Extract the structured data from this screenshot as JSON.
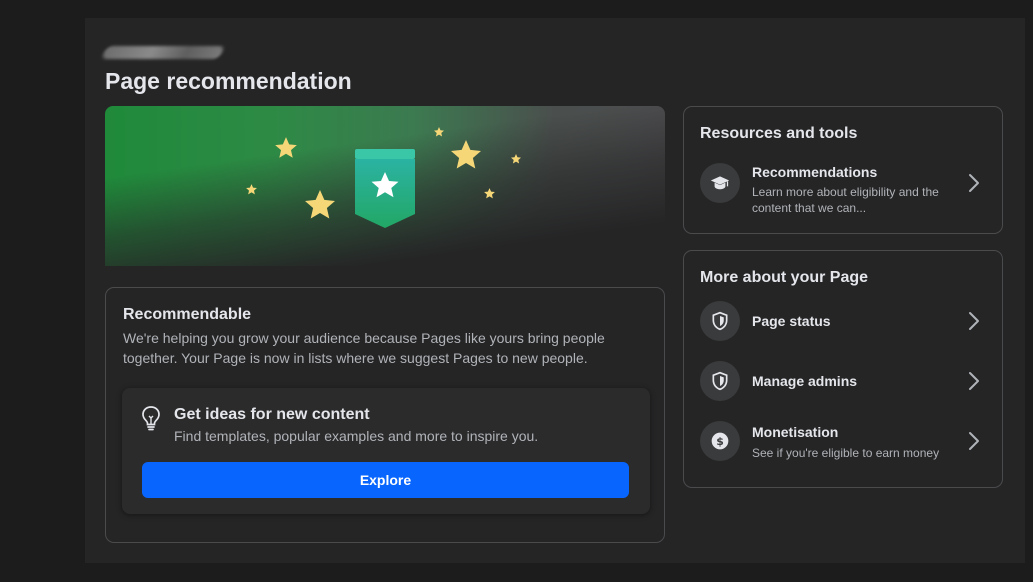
{
  "page": {
    "title": "Page recommendation"
  },
  "recommendable": {
    "title": "Recommendable",
    "description": "We're helping you grow your audience because Pages like yours bring people together. Your Page is now in lists where we suggest Pages to new people.",
    "ideas": {
      "icon": "lightbulb-icon",
      "title": "Get ideas for new content",
      "description": "Find templates, popular examples and more to inspire you.",
      "button_label": "Explore"
    }
  },
  "resources": {
    "title": "Resources and tools",
    "items": [
      {
        "icon": "graduation-cap-icon",
        "label": "Recommendations",
        "sub": "Learn more about eligibility and the content that we can..."
      }
    ]
  },
  "more": {
    "title": "More about your Page",
    "items": [
      {
        "icon": "shield-icon",
        "label": "Page status"
      },
      {
        "icon": "shield-icon",
        "label": "Manage admins"
      },
      {
        "icon": "dollar-icon",
        "label": "Monetisation",
        "sub": "See if you're eligible to earn money"
      }
    ]
  },
  "colors": {
    "background": "#1c1c1d",
    "panel": "#252526",
    "primary_button": "#0866ff",
    "star": "#f5d778",
    "badge_top": "#2bb3a3",
    "badge_bottom": "#22a765"
  }
}
